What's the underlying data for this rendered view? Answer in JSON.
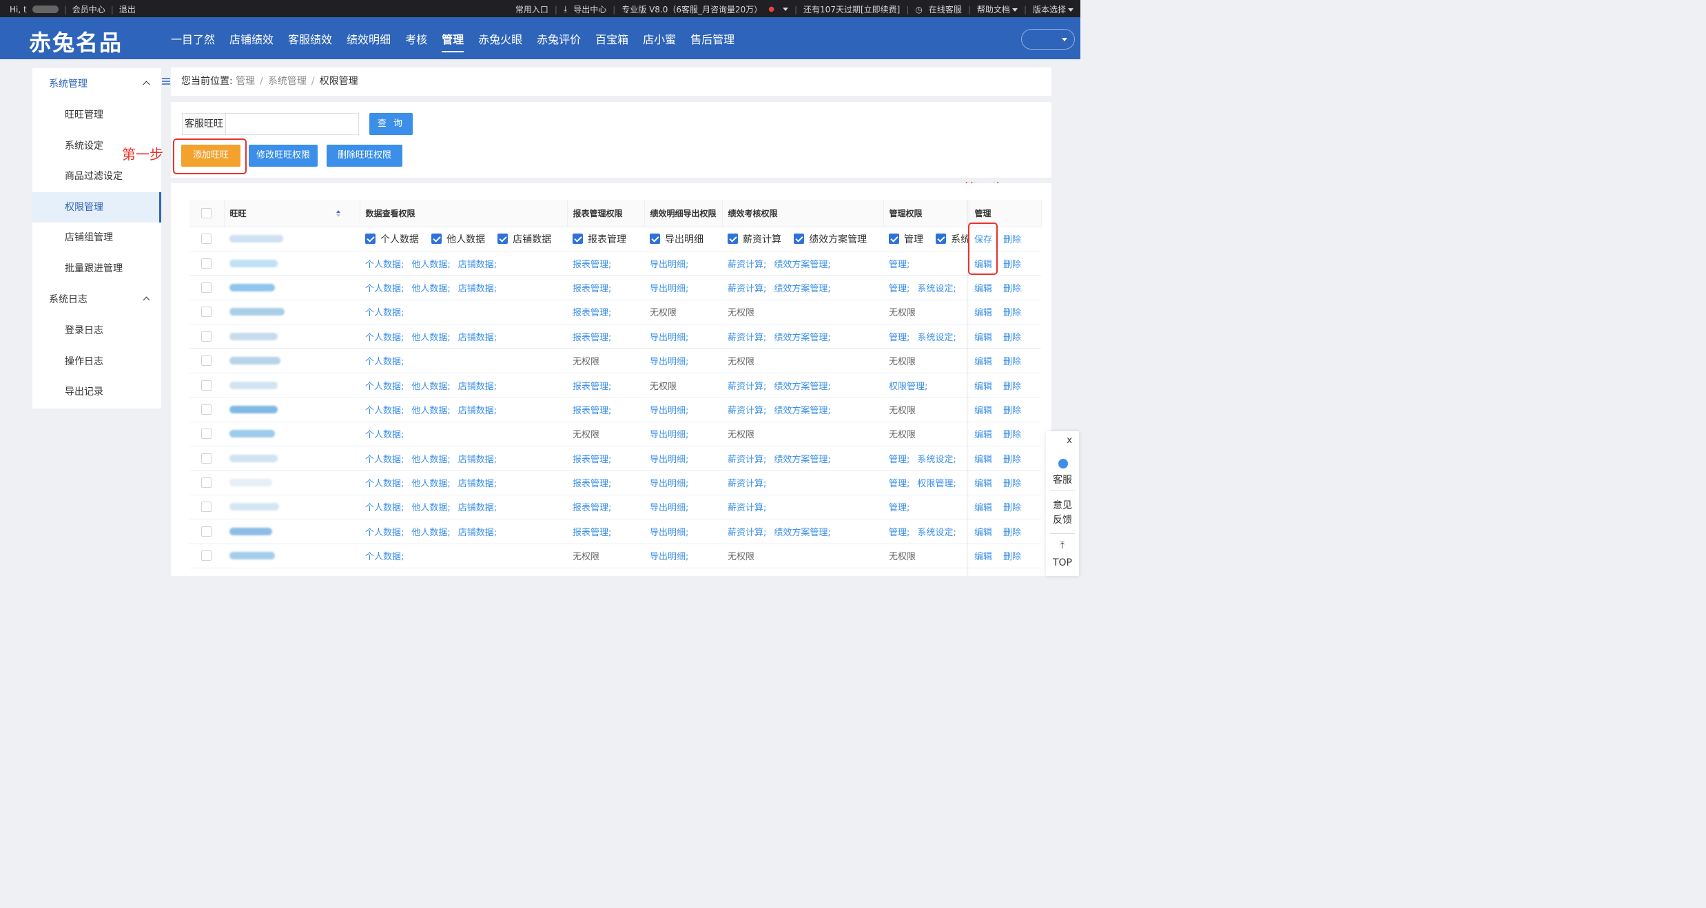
{
  "topbar": {
    "greeting": "Hi, t",
    "member_center": "会员中心",
    "logout": "退出",
    "common_entry": "常用入口",
    "export_center": "导出中心",
    "edition": "专业版 V8.0（6客服_月咨询量20万）",
    "expiry": "还有107天过期[立即续费]",
    "online_service": "在线客服",
    "help_docs": "帮助文档",
    "version_select": "版本选择"
  },
  "header": {
    "logo": "赤兔名品",
    "nav": [
      "一目了然",
      "店铺绩效",
      "客服绩效",
      "绩效明细",
      "考核",
      "管理",
      "赤兔火眼",
      "赤兔评价",
      "百宝箱",
      "店小蜜",
      "售后管理"
    ],
    "active_nav": "管理"
  },
  "sidebar": {
    "group1": "系统管理",
    "items1": [
      "旺旺管理",
      "系统设定",
      "商品过滤设定",
      "权限管理",
      "店铺组管理",
      "批量跟进管理"
    ],
    "active_item": "权限管理",
    "group2": "系统日志",
    "items2": [
      "登录日志",
      "操作日志",
      "导出记录"
    ]
  },
  "breadcrumb": {
    "prefix": "您当前位置:",
    "path": [
      "管理",
      "系统管理",
      "权限管理"
    ]
  },
  "toolbar": {
    "search_label": "客服旺旺",
    "search_value": "",
    "query_button": "查 询",
    "add_button": "添加旺旺",
    "edit_button": "修改旺旺权限",
    "delete_button": "删除旺旺权限"
  },
  "annotations": {
    "step1": "第一步",
    "step2": "第二步"
  },
  "table": {
    "headers": [
      "旺旺",
      "数据查看权限",
      "报表管理权限",
      "绩效明细导出权限",
      "绩效考核权限",
      "管理权限",
      "管理"
    ],
    "edit_row": {
      "data_view": [
        "个人数据",
        "他人数据",
        "店铺数据"
      ],
      "report": [
        "报表管理"
      ],
      "export": [
        "导出明细"
      ],
      "appraisal": [
        "薪资计算",
        "绩效方案管理"
      ],
      "manage": [
        "管理",
        "系统"
      ],
      "actions": [
        "保存",
        "删除"
      ]
    },
    "rows": [
      {
        "data_view": [
          "个人数据;",
          "他人数据;",
          "店铺数据;"
        ],
        "report": "报表管理;",
        "export": "导出明细;",
        "appraisal": [
          "薪资计算;",
          "绩效方案管理;"
        ],
        "manage": [
          "管理;"
        ]
      },
      {
        "data_view": [
          "个人数据;",
          "他人数据;",
          "店铺数据;"
        ],
        "report": "报表管理;",
        "export": "导出明细;",
        "appraisal": [
          "薪资计算;",
          "绩效方案管理;"
        ],
        "manage": [
          "管理;",
          "系统设定;"
        ]
      },
      {
        "data_view": [
          "个人数据;"
        ],
        "report": "报表管理;",
        "export": "无权限",
        "appraisal": [
          "无权限"
        ],
        "manage": [
          "无权限"
        ]
      },
      {
        "data_view": [
          "个人数据;",
          "他人数据;",
          "店铺数据;"
        ],
        "report": "报表管理;",
        "export": "导出明细;",
        "appraisal": [
          "薪资计算;",
          "绩效方案管理;"
        ],
        "manage": [
          "管理;",
          "系统设定;"
        ]
      },
      {
        "data_view": [
          "个人数据;"
        ],
        "report": "无权限",
        "export": "导出明细;",
        "appraisal": [
          "无权限"
        ],
        "manage": [
          "无权限"
        ]
      },
      {
        "data_view": [
          "个人数据;",
          "他人数据;",
          "店铺数据;"
        ],
        "report": "报表管理;",
        "export": "无权限",
        "appraisal": [
          "薪资计算;",
          "绩效方案管理;"
        ],
        "manage": [
          "权限管理;"
        ]
      },
      {
        "data_view": [
          "个人数据;",
          "他人数据;",
          "店铺数据;"
        ],
        "report": "报表管理;",
        "export": "导出明细;",
        "appraisal": [
          "薪资计算;",
          "绩效方案管理;"
        ],
        "manage": [
          "无权限"
        ]
      },
      {
        "data_view": [
          "个人数据;"
        ],
        "report": "无权限",
        "export": "导出明细;",
        "appraisal": [
          "无权限"
        ],
        "manage": [
          "无权限"
        ]
      },
      {
        "data_view": [
          "个人数据;",
          "他人数据;",
          "店铺数据;"
        ],
        "report": "报表管理;",
        "export": "导出明细;",
        "appraisal": [
          "薪资计算;",
          "绩效方案管理;"
        ],
        "manage": [
          "管理;",
          "系统设定;"
        ]
      },
      {
        "data_view": [
          "个人数据;",
          "他人数据;",
          "店铺数据;"
        ],
        "report": "报表管理;",
        "export": "导出明细;",
        "appraisal": [
          "薪资计算;"
        ],
        "manage": [
          "管理;",
          "权限管理;"
        ]
      },
      {
        "data_view": [
          "个人数据;",
          "他人数据;",
          "店铺数据;"
        ],
        "report": "报表管理;",
        "export": "导出明细;",
        "appraisal": [
          "薪资计算;"
        ],
        "manage": [
          "管理;"
        ]
      },
      {
        "data_view": [
          "个人数据;",
          "他人数据;",
          "店铺数据;"
        ],
        "report": "报表管理;",
        "export": "导出明细;",
        "appraisal": [
          "薪资计算;",
          "绩效方案管理;"
        ],
        "manage": [
          "管理;",
          "系统设定;"
        ]
      },
      {
        "data_view": [
          "个人数据;"
        ],
        "report": "无权限",
        "export": "导出明细;",
        "appraisal": [
          "无权限"
        ],
        "manage": [
          "无权限"
        ]
      }
    ],
    "row_actions": [
      "编辑",
      "删除"
    ],
    "no_permission": "无权限"
  },
  "float_panel": {
    "close": "x",
    "service": "客服",
    "feedback_1": "意见",
    "feedback_2": "反馈",
    "top": "TOP"
  },
  "colors": {
    "header_blue": "#2e64b9",
    "link_blue": "#3b8fe8",
    "add_orange": "#f3a22e",
    "annotation_red": "#e8312b"
  }
}
